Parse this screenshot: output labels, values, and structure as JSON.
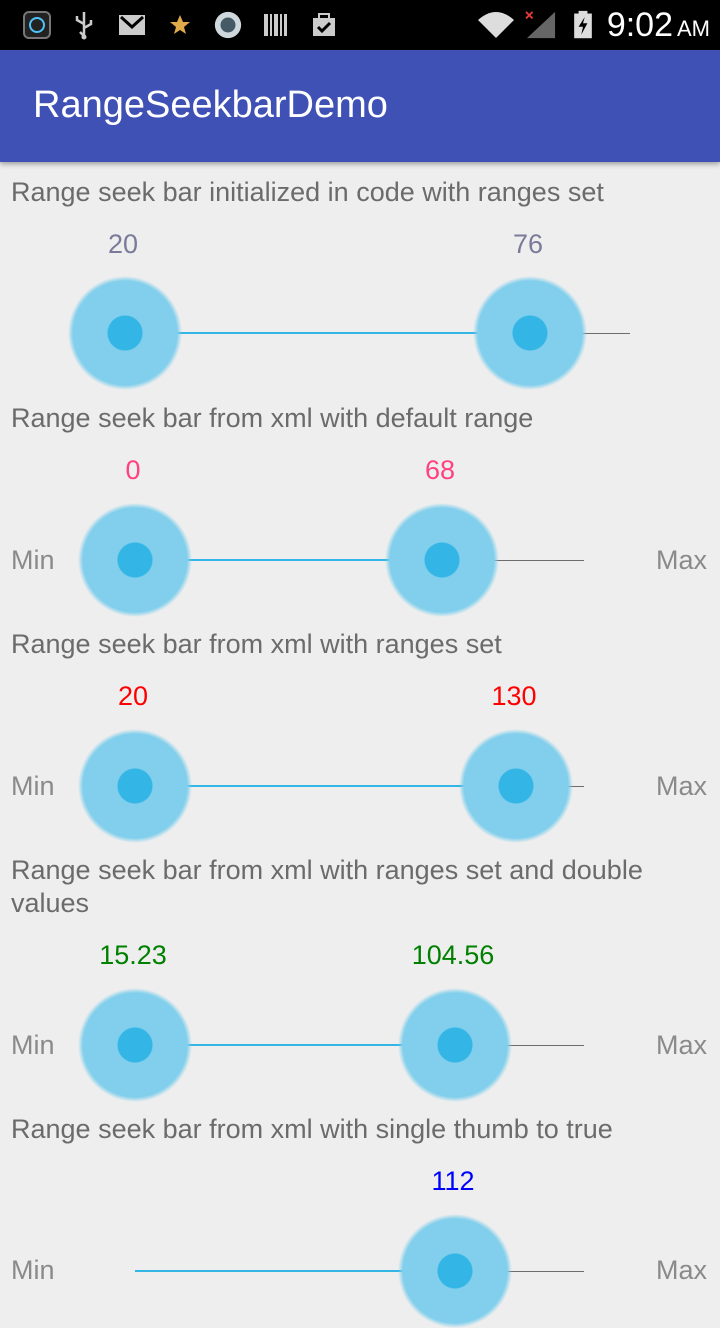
{
  "status_bar": {
    "time": "9:02",
    "ampm": "AM"
  },
  "app_bar": {
    "title": "RangeSeekbarDemo"
  },
  "sections": [
    {
      "label": "Range seek bar initialized in code with ranges set",
      "min_value": "20",
      "max_value": "76",
      "value_color": "#7a7a9a"
    },
    {
      "label": "Range seek bar from xml with default range",
      "min_value": "0",
      "max_value": "68",
      "min_text": "Min",
      "max_text": "Max",
      "value_color": "#ff4081"
    },
    {
      "label": "Range seek bar from xml with ranges set",
      "min_value": "20",
      "max_value": "130",
      "min_text": "Min",
      "max_text": "Max",
      "value_color": "#ff0000"
    },
    {
      "label": "Range seek bar from xml with ranges set and double values",
      "min_value": "15.23",
      "max_value": "104.56",
      "min_text": "Min",
      "max_text": "Max",
      "value_color": "#008000"
    },
    {
      "label": "Range seek bar from xml with single thumb to true",
      "max_value": "112",
      "min_text": "Min",
      "max_text": "Max",
      "value_color": "#0000ff"
    }
  ],
  "colors": {
    "accent": "#33b5e5",
    "primary": "#3f51b5"
  }
}
